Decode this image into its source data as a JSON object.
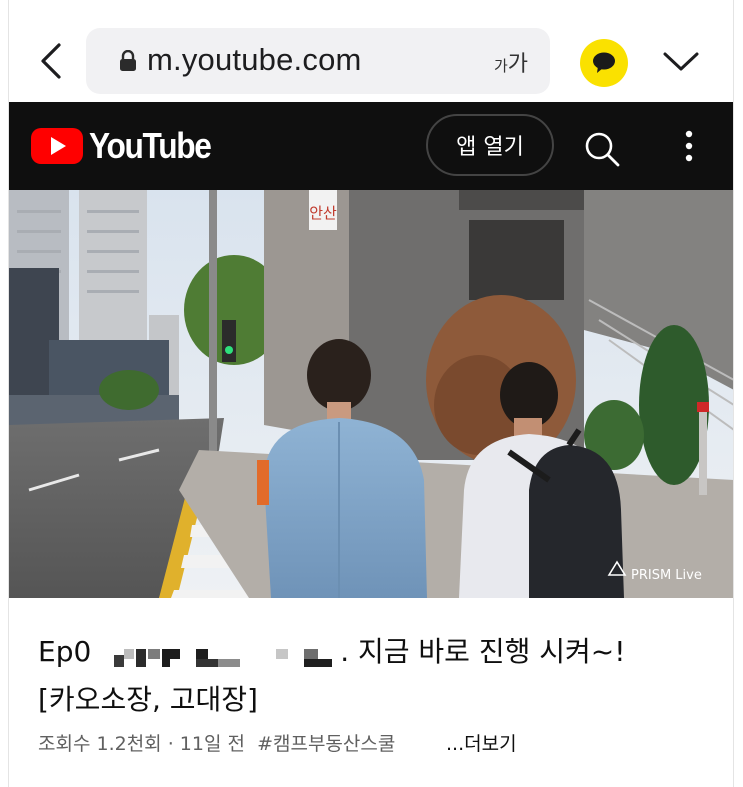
{
  "browser": {
    "url": "m.youtube.com",
    "text_size_small": "가",
    "text_size_big": "가",
    "kakao_color": "#fae100"
  },
  "youtube": {
    "logo_text": "YouTube",
    "open_app_label": "앱 열기",
    "brand_red": "#ff0000",
    "header_bg": "#0f0f0f"
  },
  "video": {
    "sign_text": "안산",
    "watermark": "PRISM Live"
  },
  "title": {
    "prefix": "Ep0",
    "suffix": ". 지금 바로 진행 시켜~!",
    "line2": "[카오소장, 고대장]"
  },
  "meta": {
    "views": "조회수 1.2천회",
    "separator": " · ",
    "age": "11일 전",
    "hashtag": "#캠프부동산스쿨",
    "more": "...더보기"
  },
  "icons": {
    "back": "chevron-left-icon",
    "lock": "lock-icon",
    "kakao": "kakao-talk-icon",
    "expand": "chevron-down-icon",
    "yt_play": "youtube-play-icon",
    "search": "search-icon",
    "kebab": "more-vertical-icon"
  }
}
